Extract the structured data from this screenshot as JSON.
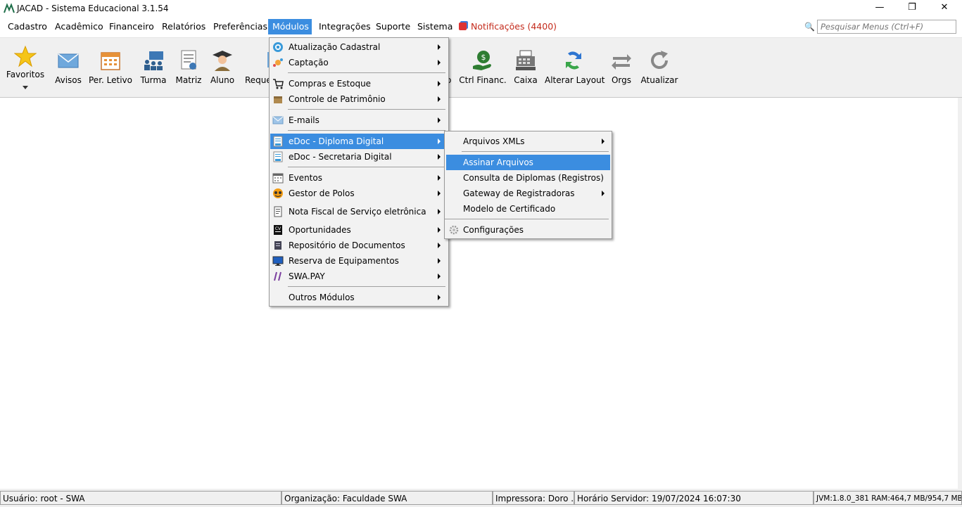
{
  "window": {
    "title": "JACAD - Sistema Educacional 3.1.54",
    "minimize_glyph": "—",
    "maximize_glyph": "❐",
    "close_glyph": "✕"
  },
  "menubar": {
    "items": [
      "Cadastro",
      "Acadêmico",
      "Financeiro",
      "Relatórios",
      "Preferências",
      "Módulos",
      "Integrações",
      "Suporte",
      "Sistema"
    ],
    "active": "Módulos",
    "notifications": "Notificações (4400)",
    "search_placeholder": "Pesquisar Menus (Ctrl+F)",
    "search_icon": "magnifier-icon"
  },
  "toolbar": {
    "favoritos": "Favoritos",
    "avisos": "Avisos",
    "per_letivo": "Per. Letivo",
    "turma": "Turma",
    "matriz": "Matriz",
    "aluno": "Aluno",
    "reque": "Reque",
    "hidden_tail": "o",
    "ctrl_financ": "Ctrl Financ.",
    "caixa": "Caixa",
    "alterar_layout": "Alterar Layout",
    "orgs": "Orgs",
    "atualizar": "Atualizar"
  },
  "modulos_menu": {
    "items": [
      {
        "label": "Atualização Cadastral",
        "icon": "refresh-badge-icon"
      },
      {
        "label": "Captação",
        "icon": "sparkle-icon"
      },
      {
        "label": "Compras e Estoque",
        "icon": "cart-icon"
      },
      {
        "label": "Controle de Patrimônio",
        "icon": "box-icon"
      },
      {
        "label": "E-mails",
        "icon": "envelope-icon"
      },
      {
        "label": "eDoc - Diploma Digital",
        "icon": "document-icon"
      },
      {
        "label": "eDoc - Secretaria Digital",
        "icon": "document-icon"
      },
      {
        "label": "Eventos",
        "icon": "calendar-icon"
      },
      {
        "label": "Gestor de Polos",
        "icon": "globe-icon"
      },
      {
        "label": "Nota Fiscal de Serviço eletrônica",
        "icon": "invoice-icon"
      },
      {
        "label": "Oportunidades",
        "icon": "cv-icon"
      },
      {
        "label": "Repositório de Documentos",
        "icon": "repository-icon"
      },
      {
        "label": "Reserva de Equipamentos",
        "icon": "monitor-icon"
      },
      {
        "label": "SWA.PAY",
        "icon": "swapay-icon"
      },
      {
        "label": "Outros Módulos",
        "icon": ""
      }
    ],
    "highlighted": "eDoc - Diploma Digital"
  },
  "edoc_submenu": {
    "items": [
      {
        "label": "Arquivos XMLs",
        "has_sub": true
      },
      {
        "label": "Assinar Arquivos",
        "has_sub": false
      },
      {
        "label": "Consulta de Diplomas (Registros)",
        "has_sub": false
      },
      {
        "label": "Gateway de Registradoras",
        "has_sub": true
      },
      {
        "label": "Modelo de Certificado",
        "has_sub": false
      },
      {
        "label": "Configurações",
        "has_sub": false,
        "icon": "gear-icon"
      }
    ],
    "highlighted": "Assinar Arquivos"
  },
  "statusbar": {
    "usuario": "Usuário: root - SWA",
    "organizacao": "Organização: Faculdade SWA",
    "impressora": "Impressora: Doro ...",
    "horario": "Horário Servidor: 19/07/2024 16:07:30",
    "jvm": "JVM:1.8.0_381  RAM:464,7 MB/954,7 MB"
  },
  "colors": {
    "highlight": "#3b8de0",
    "notification": "#c42b1c"
  }
}
